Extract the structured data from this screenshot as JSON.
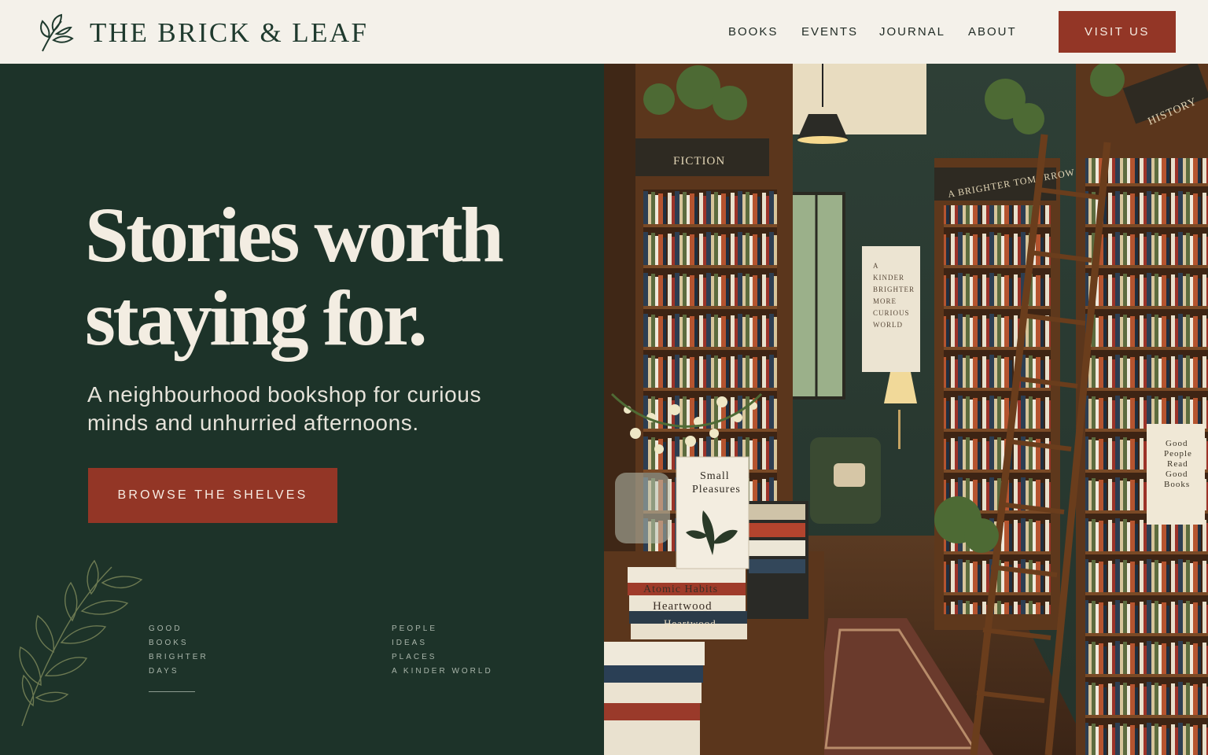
{
  "header": {
    "brand": "THE BRICK & LEAF",
    "nav": [
      "BOOKS",
      "EVENTS",
      "JOURNAL",
      "ABOUT"
    ],
    "visit_label": "VISIT US"
  },
  "hero": {
    "headline_line1": "Stories worth",
    "headline_line2": "staying for.",
    "subline": "A neighbourhood bookshop for curious minds and unhurried afternoons.",
    "cta_label": "BROWSE THE SHELVES",
    "values_left": [
      "GOOD",
      "BOOKS",
      "BRIGHTER",
      "DAYS"
    ],
    "values_right": [
      "PEOPLE",
      "IDEAS",
      "PLACES",
      "A KINDER WORLD"
    ]
  },
  "photo": {
    "sign_fiction": "FICTION",
    "sign_history": "HISTORY",
    "sign_tomorrow": "A BRIGHTER TOMORROW",
    "poster_lines": [
      "A",
      "KINDER",
      "BRIGHTER",
      "MORE",
      "CURIOUS",
      "WORLD"
    ],
    "book_small_pleasures_1": "Small",
    "book_small_pleasures_2": "Pleasures",
    "book_atomic": "Atomic Habits",
    "book_heartwood": "Heartwood",
    "book_heartwood_2": "Heartwood",
    "book_good_people": [
      "Good",
      "People",
      "Read",
      "Good",
      "Books"
    ]
  },
  "colors": {
    "hero_green": "#1d3329",
    "accent_brick": "#933626",
    "header_cream": "#f4f1ea"
  },
  "icons": [
    "leaf-logo-icon",
    "botanical-branch-icon"
  ]
}
